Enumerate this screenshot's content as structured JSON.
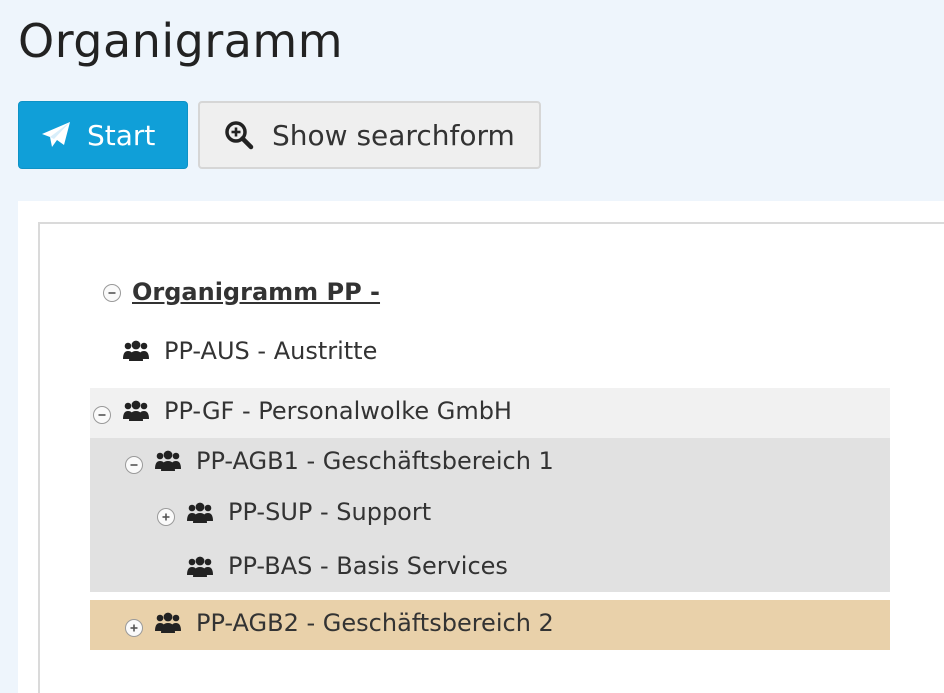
{
  "page": {
    "title": "Organigramm"
  },
  "toolbar": {
    "start_label": "Start",
    "search_label": "Show searchform"
  },
  "tree": {
    "root": {
      "label": "Organigramm PP -",
      "expanded": true
    },
    "nodes": [
      {
        "label": "PP-AUS - Austritte"
      },
      {
        "label": "PP-GF - Personalwolke GmbH",
        "expanded": true
      },
      {
        "label": "PP-AGB1 - Geschäftsbereich 1",
        "expanded": true
      },
      {
        "label": "PP-SUP - Support",
        "expanded": false
      },
      {
        "label": "PP-BAS - Basis Services"
      },
      {
        "label": "PP-AGB2 - Geschäftsbereich 2",
        "expanded": false,
        "selected": true
      }
    ]
  },
  "colors": {
    "primary": "#109fd8",
    "row_level1_bg": "#f1f1f1",
    "row_level2_bg": "#e1e1e1",
    "row_selected_bg": "#e9d1aa",
    "page_bg": "#eef5fc"
  }
}
